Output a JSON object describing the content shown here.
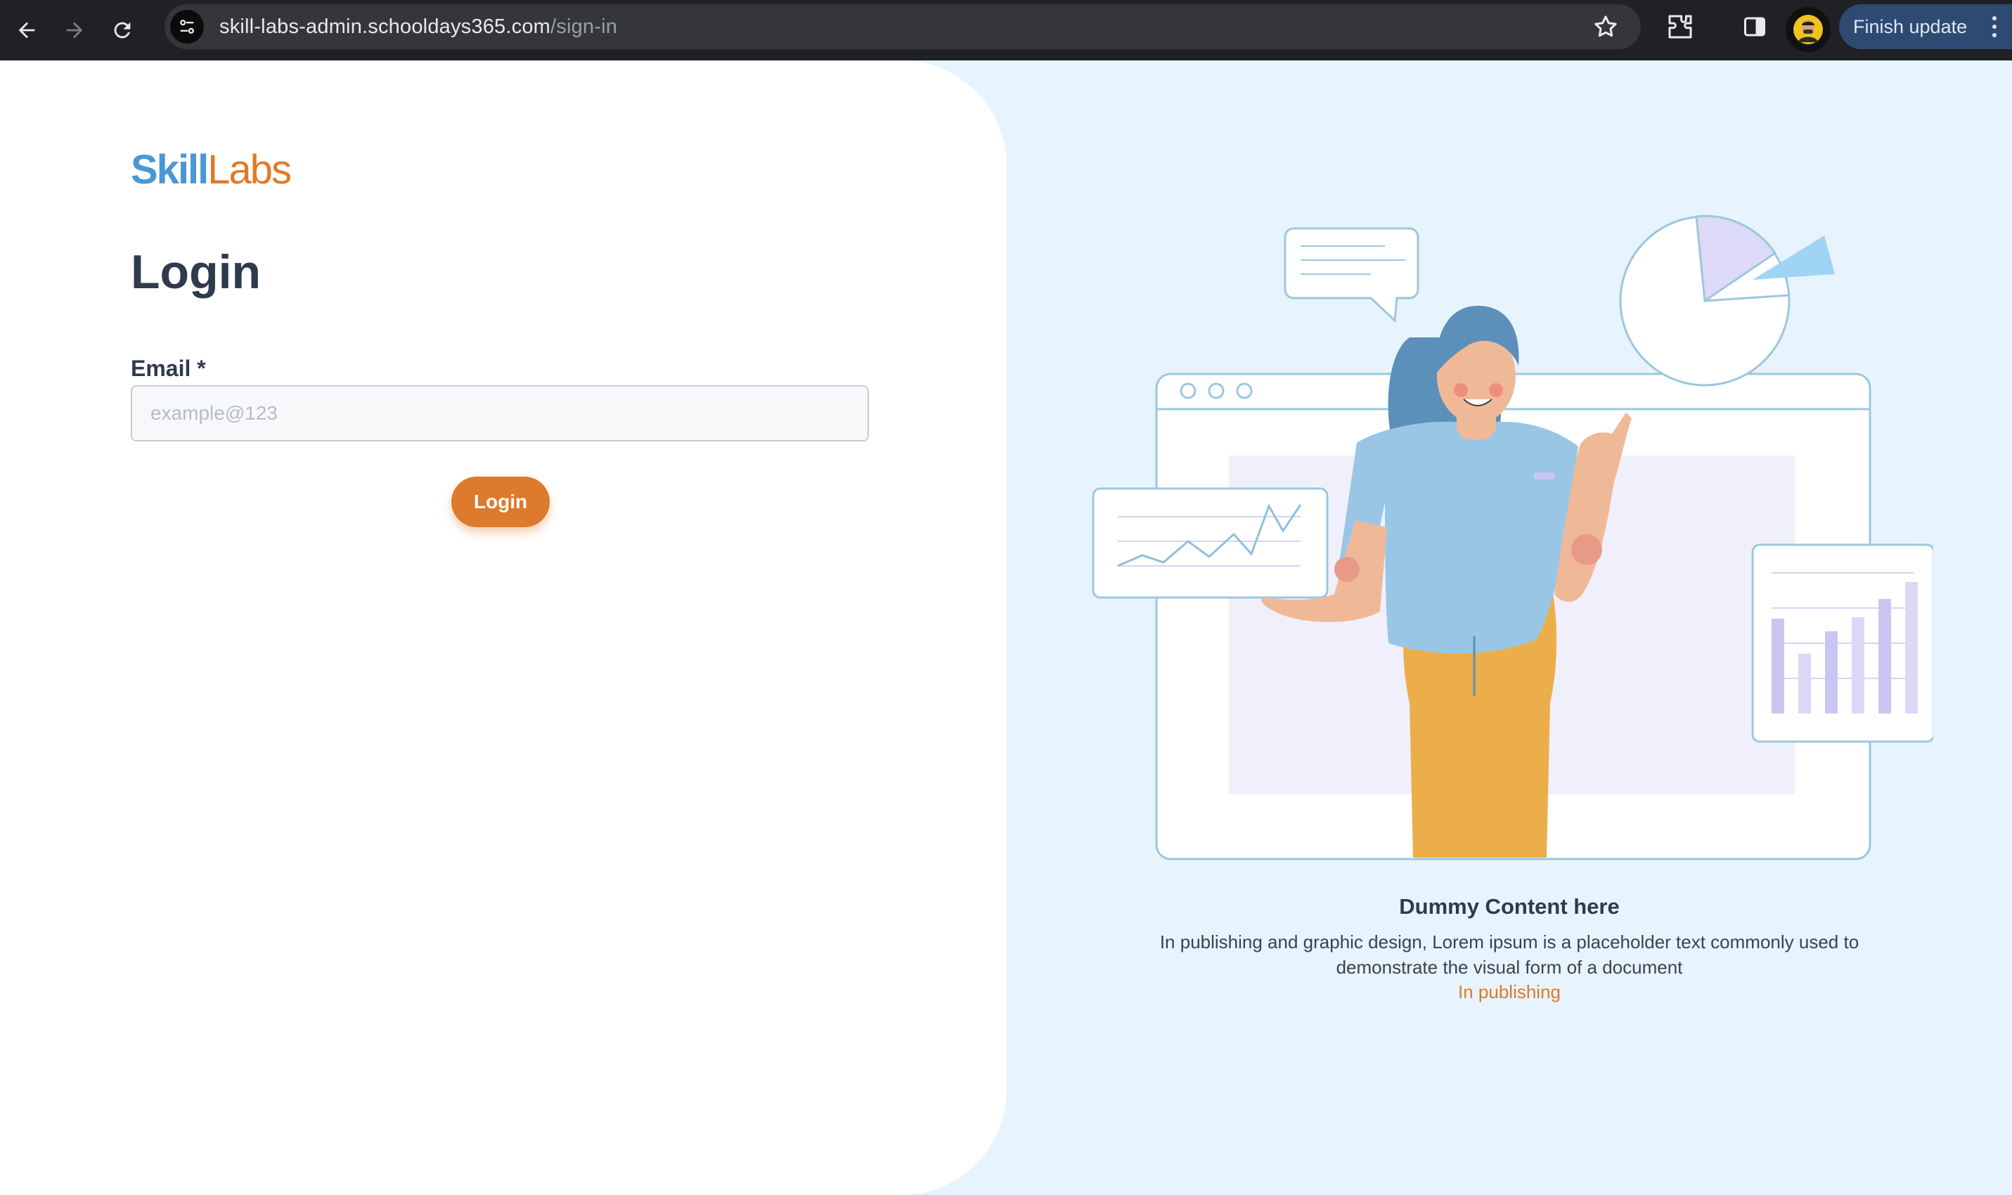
{
  "browser": {
    "url_host": "skill-labs-admin.schooldays365.com",
    "url_path": "/sign-in",
    "finish_update_label": "Finish update"
  },
  "logo": {
    "part1": "Skill",
    "part2": "Labs"
  },
  "login": {
    "title": "Login",
    "email_label": "Email *",
    "email_placeholder": "example@123",
    "email_value": "",
    "button_label": "Login"
  },
  "promo": {
    "title": "Dummy Content here",
    "description": "In publishing and graphic design, Lorem ipsum is a placeholder text commonly used to demonstrate the visual form of a document",
    "link": "In publishing"
  },
  "colors": {
    "accent_orange": "#dd7a2b",
    "brand_blue": "#4a97d4",
    "panel_bg": "#e8f4fd",
    "heading": "#2f3a4d"
  }
}
